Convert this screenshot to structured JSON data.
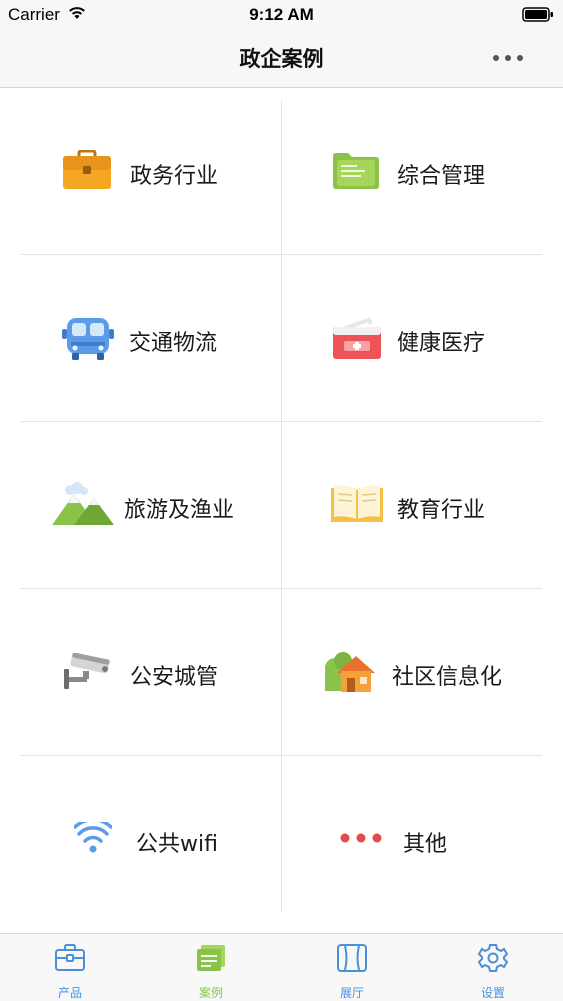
{
  "status_bar": {
    "carrier": "Carrier",
    "time": "9:12 AM"
  },
  "nav": {
    "title": "政企案例"
  },
  "categories": [
    {
      "label": "政务行业",
      "icon": "briefcase-icon"
    },
    {
      "label": "综合管理",
      "icon": "folder-icon"
    },
    {
      "label": "交通物流",
      "icon": "bus-icon"
    },
    {
      "label": "健康医疗",
      "icon": "medical-kit-icon"
    },
    {
      "label": "旅游及渔业",
      "icon": "mountain-icon"
    },
    {
      "label": "教育行业",
      "icon": "open-book-icon"
    },
    {
      "label": "公安城管",
      "icon": "security-camera-icon"
    },
    {
      "label": "社区信息化",
      "icon": "house-icon"
    },
    {
      "label": "公共wifi",
      "icon": "wifi-icon"
    },
    {
      "label": "其他",
      "icon": "ellipsis-icon"
    }
  ],
  "tabs": [
    {
      "label": "产品",
      "icon": "briefcase-outline-icon"
    },
    {
      "label": "案例",
      "icon": "document-stack-icon",
      "active": true
    },
    {
      "label": "展厅",
      "icon": "door-icon"
    },
    {
      "label": "设置",
      "icon": "gear-icon"
    }
  ],
  "colors": {
    "accent": "#4a90d9",
    "active_tab": "#8bc34a",
    "divider": "#e3e3e3"
  }
}
